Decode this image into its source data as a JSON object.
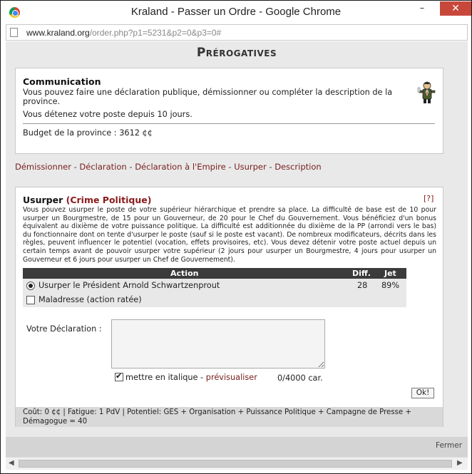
{
  "window": {
    "title": "Kraland - Passer un Ordre - Google Chrome",
    "minimize": "–",
    "maximize": "",
    "close": "✕"
  },
  "address": {
    "domain": "www.kraland.org",
    "path": "/order.php?p1=5231&p2=0&p3=0#"
  },
  "page": {
    "heading": "Prérogatives"
  },
  "communication": {
    "title": "Communication",
    "description": "Vous pouvez faire une déclaration publique, démissionner ou compléter la description de la province.",
    "since": "Vous détenez votre poste depuis 10 jours.",
    "budget": "Budget de la province : 3612 ¢¢"
  },
  "links": {
    "resign": "Démissionner",
    "declaration": "Déclaration",
    "empire": "Déclaration à l'Empire",
    "usurp": "Usurper",
    "description": "Description",
    "sep": " - "
  },
  "usurp": {
    "title": "Usurper ",
    "crime": "(Crime Politique)",
    "help": "[?]",
    "description": "Vous pouvez usurper le poste de votre supérieur hiérarchique et prendre sa place. La difficulté de base est de 10 pour usurper un Bourgmestre, de 15 pour un Gouverneur, de 20 pour le Chef du Gouvernement. Vous bénéficiez d'un bonus équivalent au dixième de votre puissance politique. La difficulté est additionnée du dixième de la PP (arrondi vers le bas) du fonctionnaire dont on tente d'usurper le poste (sauf si le poste est vacant). De nombreux modificateurs, décrits dans les règles, peuvent influencer le potentiel (vocation, effets provisoires, etc). Vous devez détenir votre poste actuel depuis un certain temps avant de pouvoir usurper votre supérieur (2 jours pour usurper un Bourgmestre, 4 jours pour usurper un Gouverneur et 6 jours pour usurper un Chef de Gouvernement).",
    "table": {
      "col_action": "Action",
      "col_diff": "Diff.",
      "col_jet": "Jet",
      "row1_action": "Usurper le Président Arnold Schwartzenprout",
      "row1_diff": "28",
      "row1_jet": "89%",
      "row2_action": "Maladresse (action ratée)"
    },
    "declaration_label": "Votre Déclaration :",
    "italic_label": "mettre en italique",
    "italic_sep": " - ",
    "preview_link": "prévisualiser",
    "counter": "0/4000 car.",
    "ok": "Ok!",
    "cost": "Coût: 0 ¢¢ | Fatigue: 1 PdV | Potentiel: GES + Organisation + Puissance Politique + Campagne de Presse + Démagogue = 40"
  },
  "footer": {
    "close": "Fermer"
  },
  "scroll": {
    "left": "◀",
    "right": "▶"
  }
}
